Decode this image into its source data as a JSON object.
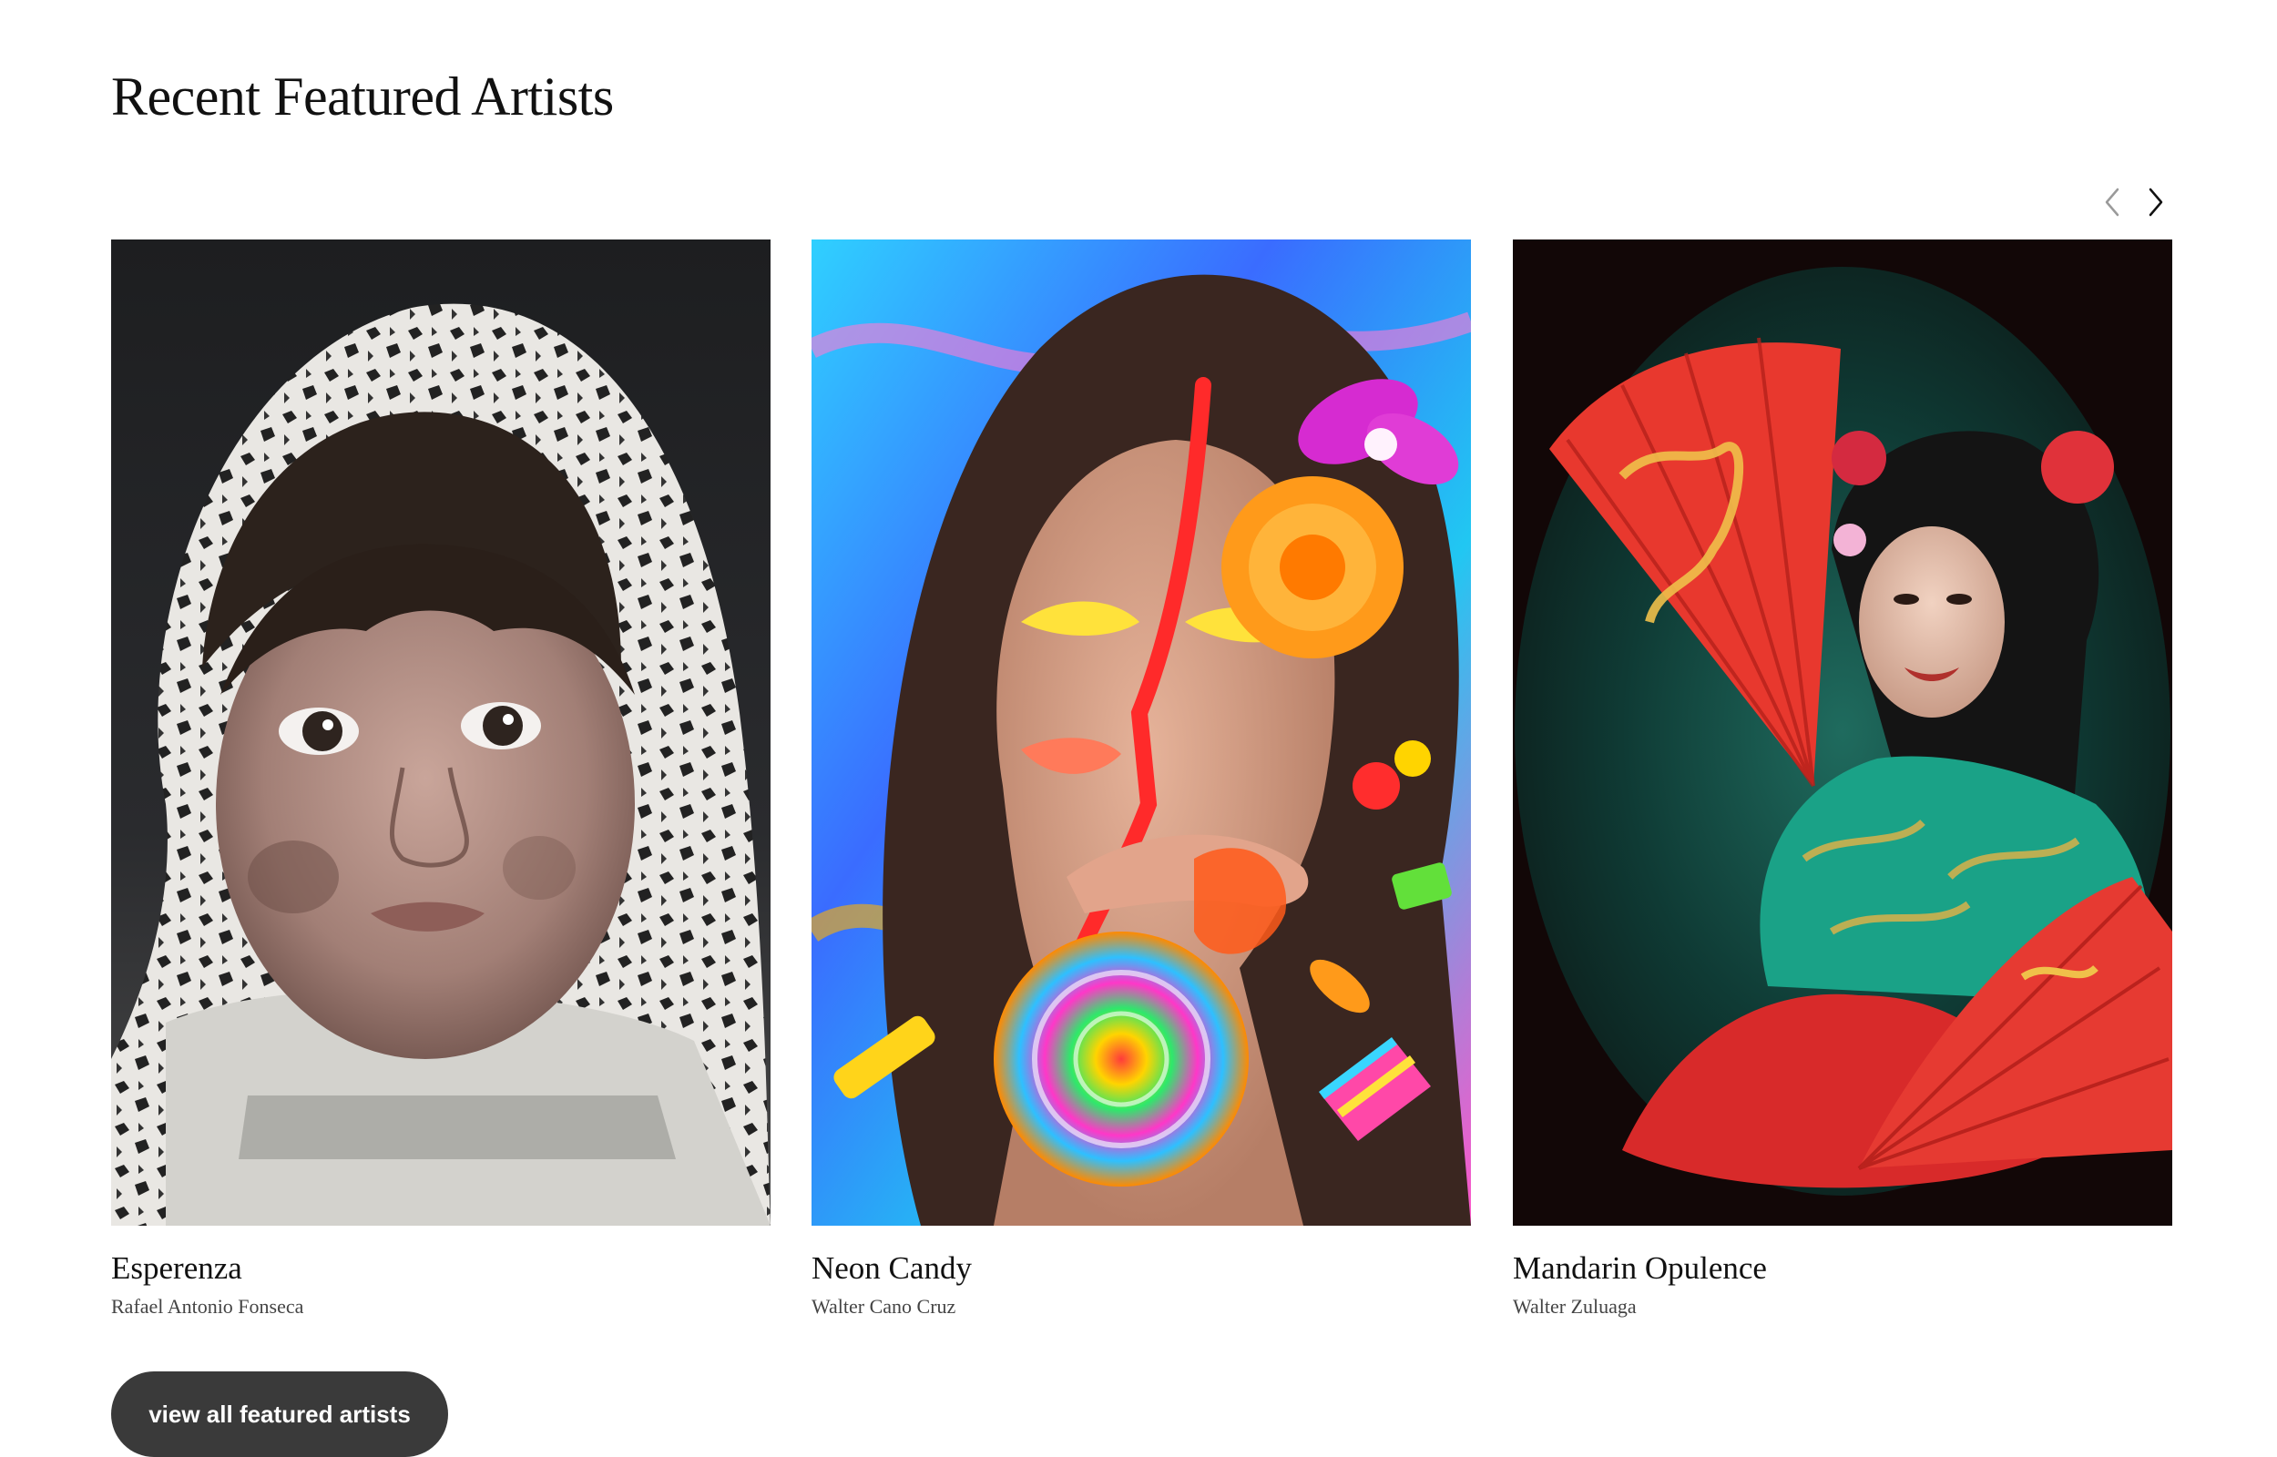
{
  "section": {
    "title": "Recent Featured Artists"
  },
  "carousel": {
    "prev_icon": "chevron-left-icon",
    "next_icon": "chevron-right-icon",
    "cards": [
      {
        "title": "Esperenza",
        "artist": "Rafael Antonio Fonseca"
      },
      {
        "title": "Neon Candy",
        "artist": "Walter Cano Cruz"
      },
      {
        "title": "Mandarin Opulence",
        "artist": "Walter Zuluaga"
      }
    ]
  },
  "footer": {
    "view_all_label": "view all featured artists"
  },
  "colors": {
    "button_bg": "#3a3a3a",
    "text": "#111111",
    "muted_text": "#444444"
  }
}
